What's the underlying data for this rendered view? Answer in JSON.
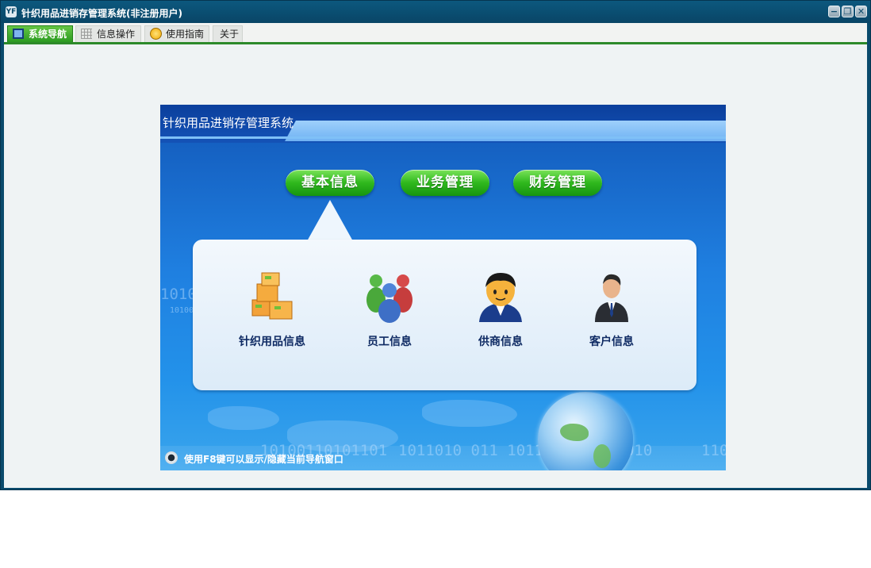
{
  "window": {
    "title": "针织用品进销存管理系统(非注册用户)",
    "app_icon": "yf-logo-icon",
    "controls": [
      "minimize-icon",
      "restore-icon",
      "close-icon"
    ]
  },
  "tabs": [
    {
      "label": "系统导航",
      "icon": "monitor-icon",
      "active": true
    },
    {
      "label": "信息操作",
      "icon": "grid-icon",
      "active": false
    },
    {
      "label": "使用指南",
      "icon": "help-icon",
      "active": false
    },
    {
      "label": "关于",
      "icon": "",
      "active": false
    }
  ],
  "panel": {
    "title": "针织用品进销存管理系统",
    "categories": [
      "基本信息",
      "业务管理",
      "财务管理"
    ],
    "selected_category": "基本信息",
    "items": [
      {
        "label": "针织用品信息",
        "icon": "boxes-icon"
      },
      {
        "label": "员工信息",
        "icon": "people-group-icon"
      },
      {
        "label": "供商信息",
        "icon": "person-icon"
      },
      {
        "label": "客户信息",
        "icon": "businessman-icon"
      }
    ],
    "hint": "使用F8键可以显示/隐藏当前导航窗口",
    "decor": {
      "bin_left": "1010",
      "bin_left_small": "10100",
      "bin_bottom": "10100110101101",
      "bin_bottom2": "1011010  011  1011011010110010",
      "bin_right": "110"
    }
  },
  "colors": {
    "titlebar": "#0a4a6c",
    "tab_active": "#2b9a21",
    "panel_blue": "#1f7fe0",
    "pill_green": "#2fb81d"
  }
}
